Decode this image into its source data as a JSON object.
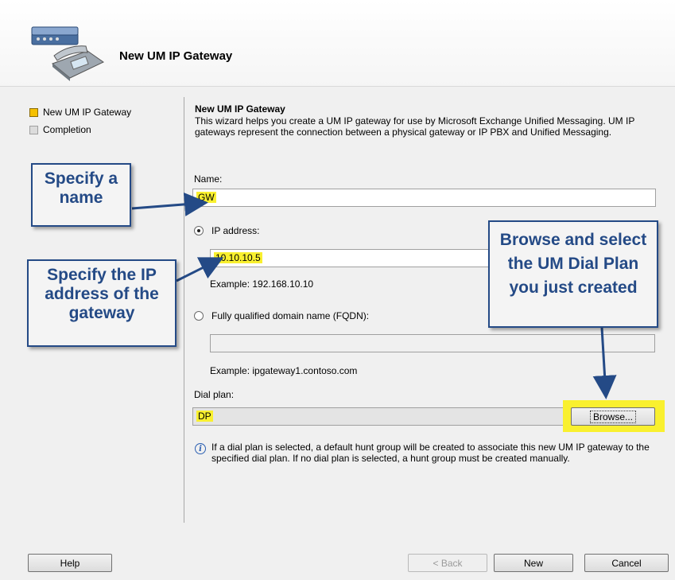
{
  "header": {
    "title": "New UM IP Gateway"
  },
  "nav": {
    "items": [
      {
        "label": "New UM IP Gateway",
        "state": "active"
      },
      {
        "label": "Completion",
        "state": "inactive"
      }
    ]
  },
  "main": {
    "heading": "New UM IP Gateway",
    "description": "This wizard helps you create a UM IP gateway for use by Microsoft Exchange Unified Messaging. UM IP gateways represent the connection between a physical gateway or IP PBX and Unified Messaging.",
    "name_label": "Name:",
    "name_value": "GW",
    "ip_radio_label": "IP address:",
    "ip_value": "10.10.10.5",
    "ip_example": "Example: 192.168.10.10",
    "fqdn_radio_label": "Fully qualified domain name (FQDN):",
    "fqdn_value": "",
    "fqdn_example": "Example: ipgateway1.contoso.com",
    "dialplan_label": "Dial plan:",
    "dialplan_value": "DP",
    "browse_label": "Browse...",
    "info_text": "If a dial plan is selected, a default hunt group will be created to associate this new UM IP gateway to the specified dial plan. If no dial plan is selected, a hunt group must be created manually."
  },
  "footer": {
    "help": "Help",
    "back": "< Back",
    "new": "New",
    "cancel": "Cancel"
  },
  "callouts": {
    "name": "Specify a name",
    "ip": "Specify the IP address of the gateway",
    "browse": "Browse and select the UM Dial Plan you just created"
  },
  "colors": {
    "accent_blue": "#244a86",
    "highlight": "#f9f02f"
  }
}
